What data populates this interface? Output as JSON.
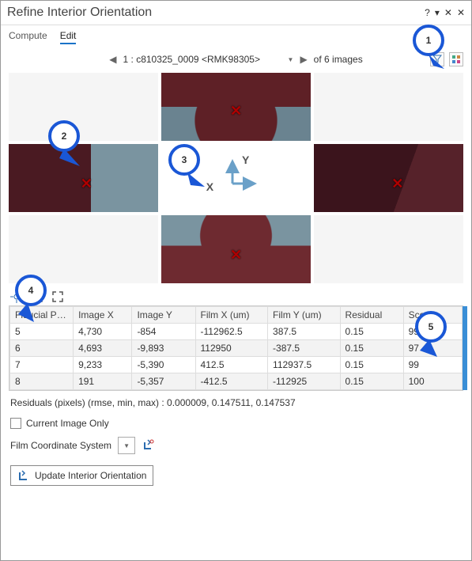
{
  "window": {
    "title": "Refine Interior Orientation"
  },
  "tabs": {
    "compute": "Compute",
    "edit": "Edit"
  },
  "nav": {
    "current": "1 : c810325_0009 <RMK98305>",
    "count_label": "of 6 images"
  },
  "callouts": {
    "c1": "1",
    "c2": "2",
    "c3": "3",
    "c4": "4",
    "c5": "5"
  },
  "axis": {
    "x": "X",
    "y": "Y"
  },
  "table": {
    "headers": [
      "Fiducial Position",
      "Image X",
      "Image Y",
      "Film X (um)",
      "Film Y (um)",
      "Residual",
      "Score"
    ],
    "rows": [
      {
        "pos": "5",
        "ix": "4,730",
        "iy": "-854",
        "fx": "-112962.5",
        "fy": "387.5",
        "res": "0.15",
        "score": "99"
      },
      {
        "pos": "6",
        "ix": "4,693",
        "iy": "-9,893",
        "fx": "112950",
        "fy": "-387.5",
        "res": "0.15",
        "score": "97"
      },
      {
        "pos": "7",
        "ix": "9,233",
        "iy": "-5,390",
        "fx": "412.5",
        "fy": "112937.5",
        "res": "0.15",
        "score": "99"
      },
      {
        "pos": "8",
        "ix": "191",
        "iy": "-5,357",
        "fx": "-412.5",
        "fy": "-112925",
        "res": "0.15",
        "score": "100"
      }
    ]
  },
  "residuals_line": "Residuals (pixels) (rmse, min, max)  : 0.000009, 0.147511, 0.147537",
  "current_only_label": "Current Image Only",
  "coord_label": "Film Coordinate System",
  "update_label": "Update Interior Orientation",
  "icons": {
    "filter": "filter-icon",
    "options": "options-icon",
    "collapse": "collapse-icon",
    "expand": "expand-icon",
    "target": "target-icon",
    "axis_small": "axis-icon"
  }
}
